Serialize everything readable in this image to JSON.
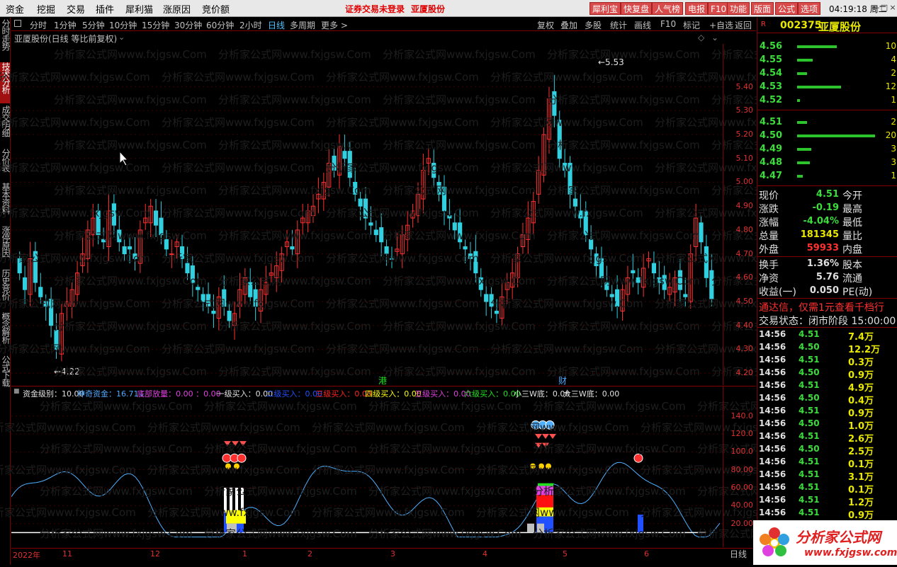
{
  "menubar": {
    "items": [
      "资金",
      "挖掘",
      "交易",
      "插件",
      "犀利猫",
      "涨原因",
      "竞价额"
    ],
    "notice": "证券交易未登录",
    "notice_stock": "亚厦股份",
    "buttons": [
      "犀利宝",
      "快复盘",
      "人气榜",
      "电报",
      "F10",
      "功能",
      "版面",
      "公式",
      "选项"
    ],
    "clock": "04:19:18 周二"
  },
  "sidebar": {
    "tabs": [
      "分时走势",
      "技术分析",
      "成交明细",
      "分价表",
      "基本资料",
      "涨停原因",
      "历史竞价",
      "概念解析",
      "公式下载"
    ],
    "active": 1
  },
  "periodbar": {
    "periods": [
      "分时",
      "1分钟",
      "5分钟",
      "10分钟",
      "15分钟",
      "30分钟",
      "60分钟",
      "2小时",
      "日线",
      "多周期",
      "更多 >"
    ],
    "active": 8,
    "tools": [
      "复权",
      "叠加",
      "多股",
      "统计",
      "画线",
      "F10",
      "标记",
      "+自选",
      "返回"
    ]
  },
  "chart": {
    "title": "亚厦股份(日线 等比前复权)",
    "high_label": "5.53",
    "low_label": "4.22",
    "markers": {
      "hk": "港",
      "fin": "财"
    },
    "price_ticks": [
      "5.40",
      "5.30",
      "5.20",
      "5.10",
      "5.00",
      "4.90",
      "4.80",
      "4.70",
      "4.60",
      "4.50",
      "4.40",
      "4.30",
      "4.20"
    ],
    "watermark": "分析家公式网www.fxjgsw.Com"
  },
  "indicator": {
    "items": [
      {
        "t": "资金级别：10.00",
        "c": "#e0e0e0"
      },
      {
        "t": "神奇资金：16.71↓",
        "c": "#4fa8ff"
      },
      {
        "t": "底部放量：0.00 ：0.00",
        "c": "#e040e0"
      },
      {
        "t": "一级买入：0.00",
        "c": "#e0e0e0"
      },
      {
        "t": "二级买入：0.00",
        "c": "#2050ff"
      },
      {
        "t": "三级买入：0.00",
        "c": "#ff2020"
      },
      {
        "t": "四级买入：0.00",
        "c": "#ffff00"
      },
      {
        "t": "五级买入：0.00",
        "c": "#e040e0"
      },
      {
        "t": "六级买入：0.00",
        "c": "#20e020"
      },
      {
        "t": "小三W底：0.00",
        "c": "#e0e0e0"
      },
      {
        "t": "大三W底：0.00",
        "c": "#e0e0e0"
      }
    ],
    "ticks": [
      "140.0",
      "120.0",
      "100.0",
      "80.00",
      "60.00",
      "40.00",
      "20.00"
    ]
  },
  "dates": [
    "2022年",
    "11",
    "12",
    "1",
    "2",
    "3",
    "4",
    "5",
    "6"
  ],
  "date_period": "日线",
  "quote": {
    "code": "002375",
    "name": "亚厦股份",
    "r": "R",
    "asks": [
      {
        "p": "4.56",
        "v": "10"
      },
      {
        "p": "4.55",
        "v": "4"
      },
      {
        "p": "4.54",
        "v": "2"
      },
      {
        "p": "4.53",
        "v": "12"
      },
      {
        "p": "4.52",
        "v": "1"
      }
    ],
    "bids": [
      {
        "p": "4.51",
        "v": "2"
      },
      {
        "p": "4.50",
        "v": "20"
      },
      {
        "p": "4.49",
        "v": "3"
      },
      {
        "p": "4.48",
        "v": "3"
      },
      {
        "p": "4.47",
        "v": "1"
      }
    ],
    "stats": [
      {
        "l": "现价",
        "v": "4.51",
        "c": "#3cdc3c",
        "l2": "今开"
      },
      {
        "l": "涨跌",
        "v": "-0.19",
        "c": "#3cdc3c",
        "l2": "最高"
      },
      {
        "l": "涨幅",
        "v": "-4.04%",
        "c": "#3cdc3c",
        "l2": "最低"
      },
      {
        "l": "总量",
        "v": "181345",
        "c": "#e8e800",
        "l2": "量比"
      },
      {
        "l": "外盘",
        "v": "59933",
        "c": "#ff3030",
        "l2": "内盘"
      }
    ],
    "stats2": [
      {
        "l": "换手",
        "v": "1.36%",
        "l2": "股本"
      },
      {
        "l": "净资",
        "v": "5.76",
        "l2": "流通"
      },
      {
        "l": "收益(一)",
        "v": "0.050",
        "l2": "PE(动)"
      }
    ],
    "ad": "通达信，仅需1元查看千档行",
    "status": "交易状态：闭市阶段 15:00:00",
    "ticks": [
      {
        "t": "14:56",
        "p": "4.51",
        "v": "7.4万"
      },
      {
        "t": "14:56",
        "p": "4.50",
        "v": "12.2万"
      },
      {
        "t": "14:56",
        "p": "4.51",
        "v": "0.3万"
      },
      {
        "t": "14:56",
        "p": "4.50",
        "v": "0.9万"
      },
      {
        "t": "14:56",
        "p": "4.51",
        "v": "4.9万"
      },
      {
        "t": "14:56",
        "p": "4.50",
        "v": "0.4万"
      },
      {
        "t": "14:56",
        "p": "4.51",
        "v": "0.9万"
      },
      {
        "t": "14:56",
        "p": "4.50",
        "v": "1.0万"
      },
      {
        "t": "14:56",
        "p": "4.51",
        "v": "2.6万"
      },
      {
        "t": "14:56",
        "p": "4.50",
        "v": "2.5万"
      },
      {
        "t": "14:56",
        "p": "4.51",
        "v": "0.1万"
      },
      {
        "t": "14:56",
        "p": "4.51",
        "v": "3.1万"
      },
      {
        "t": "14:56",
        "p": "4.51",
        "v": "0.1万"
      },
      {
        "t": "14:56",
        "p": "4.51",
        "v": "1.2万"
      },
      {
        "t": "14:56",
        "p": "4.51",
        "v": "0.9万"
      }
    ]
  },
  "logo": {
    "text": "分析家公式网",
    "url": "www.fxjgsw.com"
  },
  "colors": {
    "up": "#ff3030",
    "down": "#30d0e0",
    "grid": "#800000"
  }
}
